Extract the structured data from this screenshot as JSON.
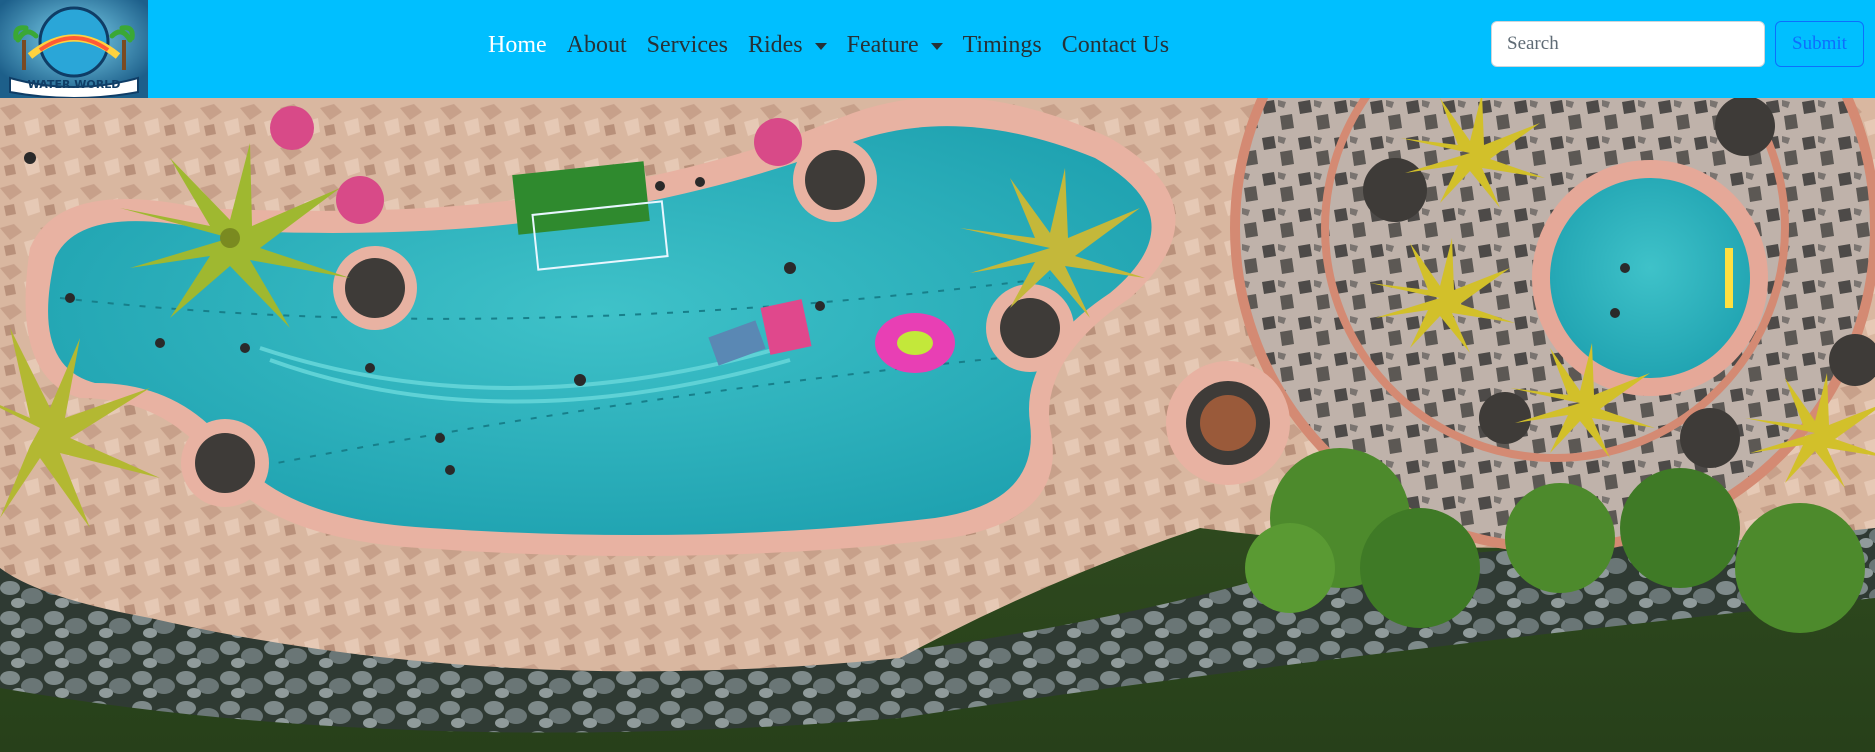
{
  "brand": {
    "logo_text": "WATER WORLD"
  },
  "nav": {
    "items": [
      {
        "label": "Home",
        "active": true,
        "dropdown": false
      },
      {
        "label": "About",
        "active": false,
        "dropdown": false
      },
      {
        "label": "Services",
        "active": false,
        "dropdown": false
      },
      {
        "label": "Rides",
        "active": false,
        "dropdown": true
      },
      {
        "label": "Feature",
        "active": false,
        "dropdown": true
      },
      {
        "label": "Timings",
        "active": false,
        "dropdown": false
      },
      {
        "label": "Contact Us",
        "active": false,
        "dropdown": false
      }
    ]
  },
  "search": {
    "placeholder": "Search",
    "value": "",
    "submit_label": "Submit"
  },
  "colors": {
    "navbar_bg": "#00bfff",
    "active_link": "#ffffff",
    "link": "#263238",
    "submit_outline": "#0d6efd"
  }
}
